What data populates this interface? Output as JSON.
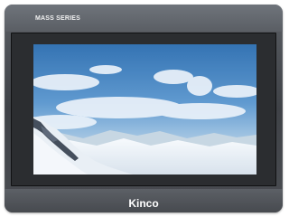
{
  "device": {
    "series_label": "MASS  SERIES",
    "brand": "Kinco"
  },
  "screen": {
    "content": "mountain-sky-landscape",
    "colors": {
      "sky_top": "#2e6fb1",
      "sky_bottom": "#b7d3ea",
      "snow": "#eef3f8",
      "rock": "#3f4a58"
    }
  }
}
